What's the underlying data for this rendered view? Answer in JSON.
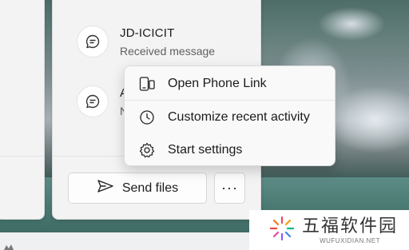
{
  "activities": [
    {
      "title": "JD-ICICIT",
      "subtitle": "Received message"
    },
    {
      "title": "A",
      "subtitle": "N"
    }
  ],
  "context_menu": {
    "items": [
      {
        "icon": "phone-link-icon",
        "label": "Open Phone Link"
      },
      {
        "icon": "clock-icon",
        "label": "Customize recent activity"
      },
      {
        "icon": "gear-icon",
        "label": "Start settings"
      }
    ]
  },
  "actions": {
    "send_files_label": "Send files",
    "more_label": "···"
  },
  "watermark": {
    "cn_text": "五福软件园",
    "en_text": "WUFUXIDIAN.NET"
  },
  "colors": {
    "panel_bg": "#f3f3f3",
    "menu_bg": "#f9f9f9",
    "text": "#1b1b1b",
    "subtext": "#5f5f5f"
  }
}
